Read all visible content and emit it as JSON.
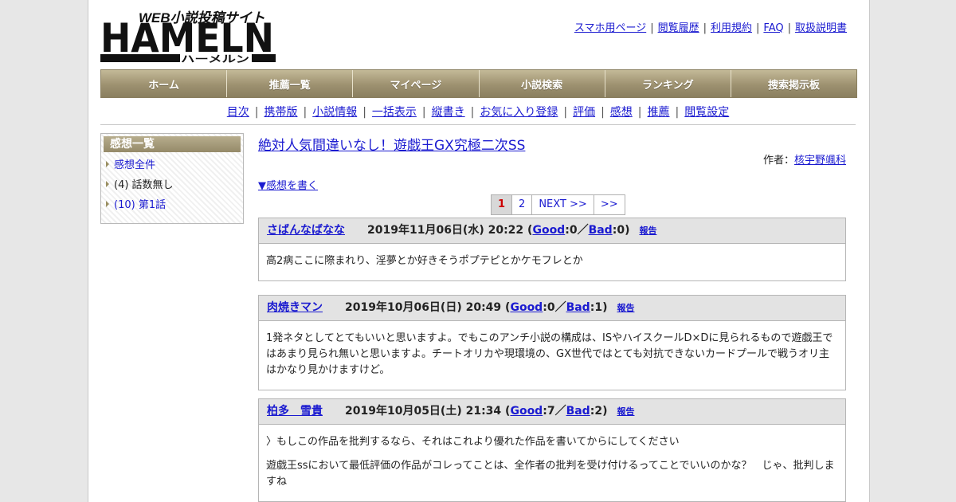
{
  "logo": {
    "tagline": "WEB小説投稿サイト",
    "word": "HAMELN",
    "kana": "ハーメルン"
  },
  "top_links": [
    "スマホ用ページ",
    "閲覧履歴",
    "利用規約",
    "FAQ",
    "取扱説明書"
  ],
  "nav": [
    "ホーム",
    "推薦一覧",
    "マイページ",
    "小説検索",
    "ランキング",
    "捜索掲示板"
  ],
  "sub_nav": [
    "目次",
    "携帯版",
    "小説情報",
    "一括表示",
    "縦書き",
    "お気に入り登録",
    "評価",
    "感想",
    "推薦",
    "閲覧設定"
  ],
  "sidebar": {
    "title": "感想一覧",
    "items": [
      {
        "label": "感想全件",
        "link": true
      },
      {
        "label": "(4) 話数無し",
        "link": false
      },
      {
        "label": "(10) 第1話",
        "link": true
      }
    ]
  },
  "novel": {
    "title": "絶対人気間違いなし！遊戯王GX究極二次SS",
    "author_label": "作者：",
    "author": "核宇野颯科"
  },
  "write_link": "▼感想を書く",
  "pager": {
    "current": "1",
    "pages": [
      "2"
    ],
    "next": "NEXT >>",
    "last": ">>"
  },
  "reviews": [
    {
      "name": "さばんなばなな",
      "date": "2019年11月06日(水) 20:22",
      "good_label": "Good",
      "good": "0",
      "bad_label": "Bad",
      "bad": "0",
      "report": "報告",
      "body": [
        "高2病ここに際まれり、淫夢とか好きそうポプテピとかケモフレとか"
      ]
    },
    {
      "name": "肉焼きマン",
      "date": "2019年10月06日(日) 20:49",
      "good_label": "Good",
      "good": "0",
      "bad_label": "Bad",
      "bad": "1",
      "report": "報告",
      "body": [
        "1発ネタとしてとてもいいと思いますよ。でもこのアンチ小説の構成は、ISやハイスクールD×Dに見られるもので遊戯王ではあまり見られ無いと思いますよ。チートオリカや現環境の、GX世代ではとても対抗できないカードプールで戦うオリ主はかなり見かけますけど。"
      ]
    },
    {
      "name": "柏多　雪貴",
      "date": "2019年10月05日(土) 21:34",
      "good_label": "Good",
      "good": "7",
      "bad_label": "Bad",
      "bad": "2",
      "report": "報告",
      "body": [
        "〉もしこの作品を批判するなら、それはこれより優れた作品を書いてからにしてください",
        "遊戯王ssにおいて最低評価の作品がコレってことは、全作者の批判を受け付けるってことでいいのかな？　じゃ、批判しますね"
      ]
    }
  ]
}
